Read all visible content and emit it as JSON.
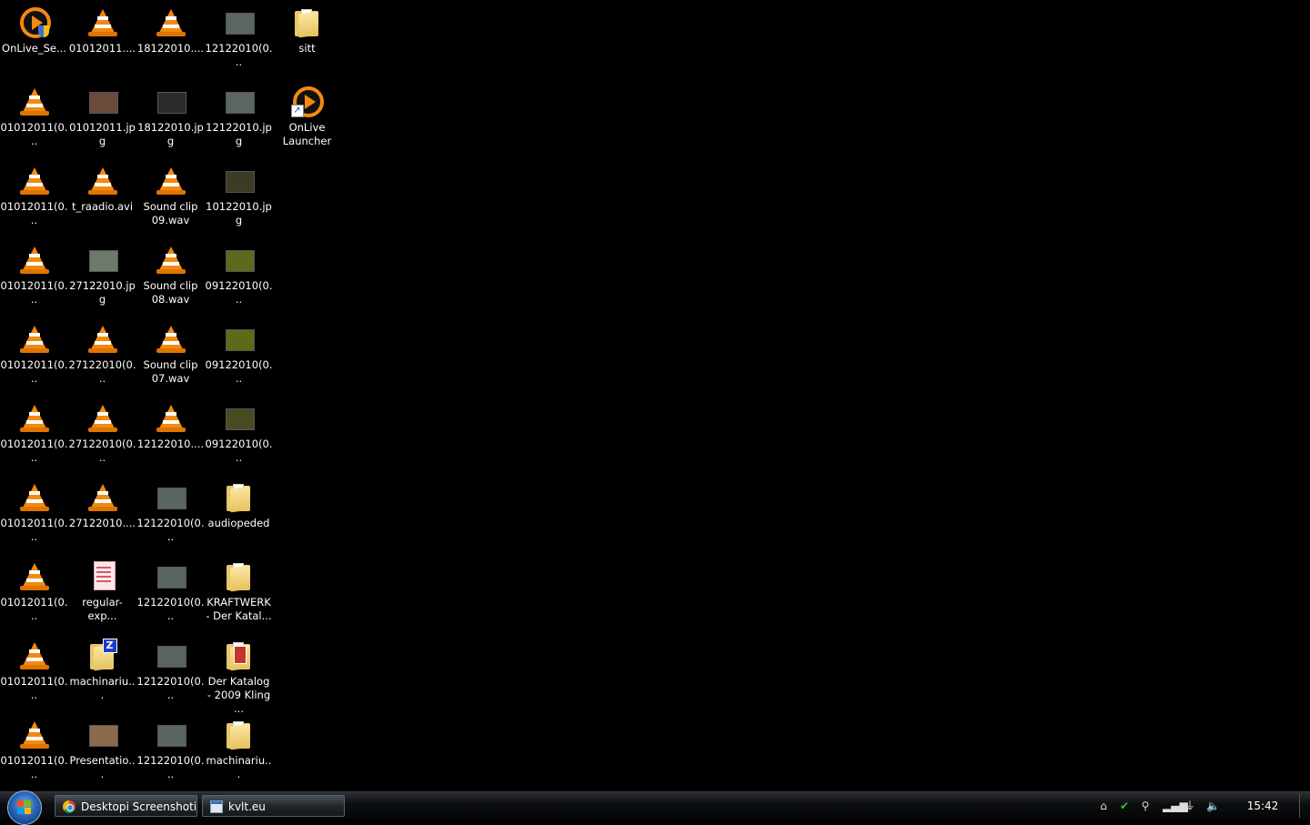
{
  "desktop": {
    "icons": [
      {
        "label": "OnLive_Se...",
        "type": "onlive-setup"
      },
      {
        "label": "01012011....",
        "type": "vlc"
      },
      {
        "label": "18122010....",
        "type": "vlc"
      },
      {
        "label": "12122010(0...",
        "type": "image",
        "color": "#5c6660"
      },
      {
        "label": "sitt",
        "type": "folder"
      },
      {
        "label": "01012011(0...",
        "type": "vlc"
      },
      {
        "label": "01012011.jpg",
        "type": "image",
        "color": "#6a4a3a"
      },
      {
        "label": "18122010.jpg",
        "type": "image",
        "color": "#2b2b2b"
      },
      {
        "label": "12122010.jpg",
        "type": "image",
        "color": "#5c6660"
      },
      {
        "label": "OnLive Launcher",
        "type": "onlive"
      },
      {
        "label": "01012011(0...",
        "type": "vlc"
      },
      {
        "label": "t_raadio.avi",
        "type": "vlc"
      },
      {
        "label": "Sound clip 09.wav",
        "type": "vlc"
      },
      {
        "label": "10122010.jpg",
        "type": "image",
        "color": "#3e3a24"
      },
      {
        "label": "01012011(0...",
        "type": "vlc"
      },
      {
        "label": "27122010.jpg",
        "type": "image",
        "color": "#6c7a6c"
      },
      {
        "label": "Sound clip 08.wav",
        "type": "vlc"
      },
      {
        "label": "09122010(0...",
        "type": "image",
        "color": "#5b6a1c"
      },
      {
        "label": "01012011(0...",
        "type": "vlc"
      },
      {
        "label": "27122010(0...",
        "type": "vlc"
      },
      {
        "label": "Sound clip 07.wav",
        "type": "vlc"
      },
      {
        "label": "09122010(0...",
        "type": "image",
        "color": "#5e6a18"
      },
      {
        "label": "01012011(0...",
        "type": "vlc"
      },
      {
        "label": "27122010(0...",
        "type": "vlc"
      },
      {
        "label": "12122010....",
        "type": "vlc"
      },
      {
        "label": "09122010(0...",
        "type": "image",
        "color": "#4a4a20"
      },
      {
        "label": "01012011(0...",
        "type": "vlc"
      },
      {
        "label": "27122010....",
        "type": "vlc"
      },
      {
        "label": "12122010(0...",
        "type": "image",
        "color": "#5a6460"
      },
      {
        "label": "audiopeded",
        "type": "folder"
      },
      {
        "label": "01012011(0...",
        "type": "vlc"
      },
      {
        "label": "regular-exp...",
        "type": "text"
      },
      {
        "label": "12122010(0...",
        "type": "image",
        "color": "#5a6460"
      },
      {
        "label": "KRAFTWERK - Der Katal...",
        "type": "folder"
      },
      {
        "label": "01012011(0...",
        "type": "vlc"
      },
      {
        "label": "machinariu...",
        "type": "zip"
      },
      {
        "label": "12122010(0...",
        "type": "image",
        "color": "#5a6460"
      },
      {
        "label": "Der Katalog - 2009 Kling ...",
        "type": "folder-music"
      },
      {
        "label": "01012011(0...",
        "type": "vlc"
      },
      {
        "label": "Presentatio...",
        "type": "image",
        "color": "#8a6a4a"
      },
      {
        "label": "12122010(0...",
        "type": "image",
        "color": "#5a6460"
      },
      {
        "label": "machinariu...",
        "type": "folder"
      }
    ]
  },
  "taskbar": {
    "start_button": "start-orb",
    "tasks": [
      {
        "label": "Desktopi Screenshoti...",
        "icon": "chrome-icon"
      },
      {
        "label": "kvlt.eu",
        "icon": "window-icon"
      }
    ],
    "clock": "15:42"
  }
}
